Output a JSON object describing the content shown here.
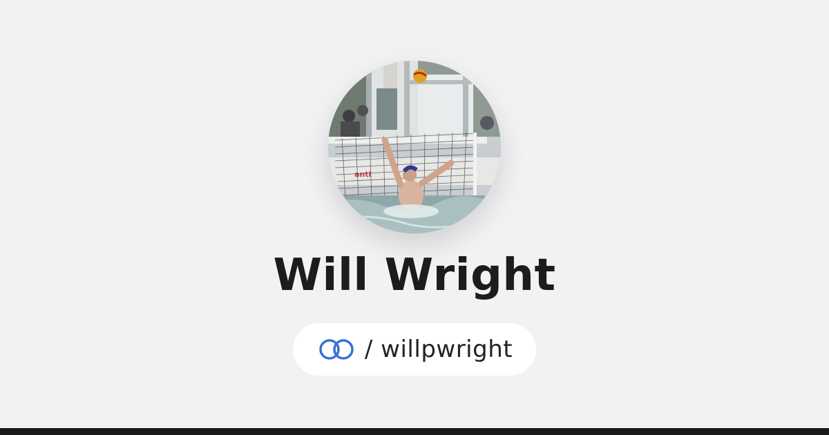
{
  "profile": {
    "display_name": "Will Wright",
    "handle_text": "/ willpwright",
    "avatar_alt": "avatar photo",
    "brand_icon": "linked-rings-icon"
  },
  "colors": {
    "background": "#f2f2f4",
    "name_text": "#1c1c1e",
    "pill_background": "#ffffff",
    "brand_icon": "#3a6fd8",
    "bottom_bar": "#1a1a1c"
  }
}
